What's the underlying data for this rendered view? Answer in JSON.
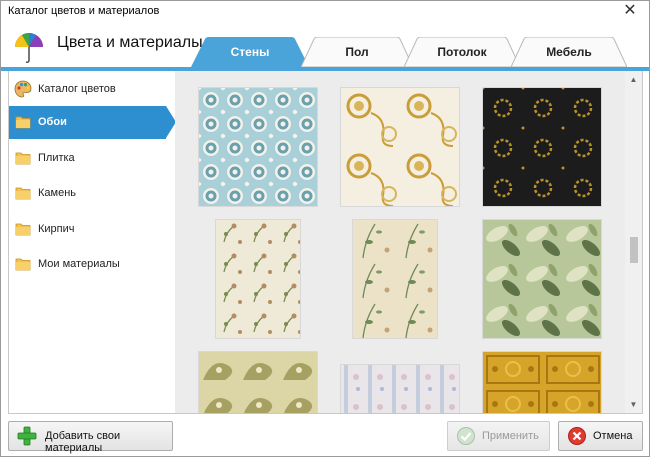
{
  "window": {
    "title": "Каталог цветов и материалов"
  },
  "header": {
    "title": "Цвета и материалы"
  },
  "tabs": [
    {
      "label": "Стены",
      "active": true
    },
    {
      "label": "Пол",
      "active": false
    },
    {
      "label": "Потолок",
      "active": false
    },
    {
      "label": "Мебель",
      "active": false
    }
  ],
  "sidebar": {
    "items": [
      {
        "label": "Каталог цветов",
        "icon": "palette-icon",
        "active": false
      },
      {
        "label": "Обои",
        "icon": "folder-icon",
        "active": true
      },
      {
        "label": "Плитка",
        "icon": "folder-icon",
        "active": false
      },
      {
        "label": "Камень",
        "icon": "folder-icon",
        "active": false
      },
      {
        "label": "Кирпич",
        "icon": "folder-icon",
        "active": false
      },
      {
        "label": "Мои материалы",
        "icon": "folder-icon",
        "active": false
      }
    ]
  },
  "textures": [
    {
      "name": "blue-medallion-wallpaper",
      "colors": [
        "#a9cfd9",
        "#6a9fb0",
        "#f2f2e8"
      ]
    },
    {
      "name": "gold-floral-on-cream-wallpaper",
      "colors": [
        "#f4efe0",
        "#c99e3a",
        "#d9b55a"
      ]
    },
    {
      "name": "black-gold-wreath-wallpaper",
      "colors": [
        "#1c1c1c",
        "#b8922e",
        "#2a2a2a"
      ]
    },
    {
      "name": "floral-sprig-wallpaper",
      "colors": [
        "#efe9d8",
        "#7a8c4c",
        "#b58c62"
      ]
    },
    {
      "name": "botanical-vine-wallpaper",
      "colors": [
        "#ece2c8",
        "#6f8a56",
        "#c2a374"
      ]
    },
    {
      "name": "green-leaf-damask-wallpaper",
      "colors": [
        "#b8c79a",
        "#5e7448",
        "#dfe3c4"
      ]
    },
    {
      "name": "olive-paisley-wallpaper",
      "colors": [
        "#dcd6a6",
        "#8f8a48",
        "#eee9c8"
      ]
    },
    {
      "name": "pastel-striped-floral-wallpaper",
      "colors": [
        "#eae5e8",
        "#a9bcd6",
        "#d8c2cc"
      ]
    },
    {
      "name": "gold-ornate-panel-wallpaper",
      "colors": [
        "#d5a428",
        "#a87712",
        "#e9c04c"
      ]
    }
  ],
  "footer": {
    "add_label": "Добавить свои материалы",
    "apply_label": "Применить",
    "cancel_label": "Отмена"
  },
  "colors": {
    "accent": "#2e8fd0",
    "band": "#4aa3d9",
    "content_bg": "#ececec"
  }
}
